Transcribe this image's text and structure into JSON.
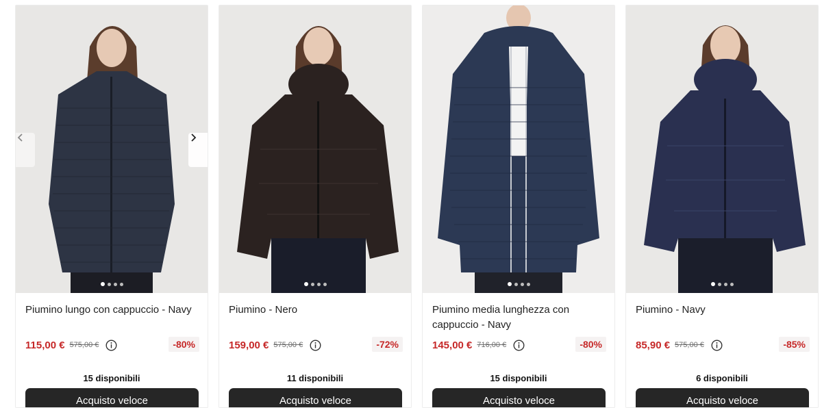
{
  "products": [
    {
      "name": "Piumino lungo con cappuccio - Navy",
      "price": "115,00 €",
      "old_price": "575,00 €",
      "discount": "-80%",
      "availability": "15 disponibili",
      "button_label": "Acquisto veloce",
      "coat_color": "#2d3444",
      "image_slides": 4,
      "active_slide": 1
    },
    {
      "name": "Piumino - Nero",
      "price": "159,00 €",
      "old_price": "575,00 €",
      "discount": "-72%",
      "availability": "11 disponibili",
      "button_label": "Acquisto veloce",
      "coat_color": "#2b2220",
      "image_slides": 4,
      "active_slide": 1
    },
    {
      "name": "Piumino media lunghezza con cappuccio - Navy",
      "price": "145,00 €",
      "old_price": "716,00 €",
      "discount": "-80%",
      "availability": "15 disponibili",
      "button_label": "Acquisto veloce",
      "coat_color": "#2c3954",
      "image_slides": 4,
      "active_slide": 1
    },
    {
      "name": "Piumino - Navy",
      "price": "85,90 €",
      "old_price": "575,00 €",
      "discount": "-85%",
      "availability": "6 disponibili",
      "button_label": "Acquisto veloce",
      "coat_color": "#2a3050",
      "image_slides": 4,
      "active_slide": 1
    }
  ],
  "icons": {
    "info": "info-circle-icon",
    "prev": "chevron-left-icon",
    "next": "chevron-right-icon"
  },
  "colors": {
    "price": "#c62828",
    "discount_bg": "#f5f2f2",
    "button_bg": "#262626",
    "button_text": "#ffffff"
  }
}
